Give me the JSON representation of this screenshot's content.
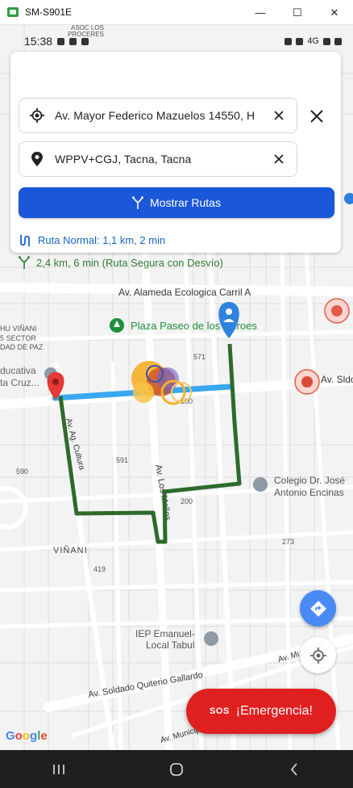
{
  "window": {
    "title": "SM-S901E",
    "minimize": "—",
    "maximize": "☐",
    "close": "✕"
  },
  "status": {
    "time": "15:38",
    "right": "4G"
  },
  "search": {
    "origin": "Av. Mayor Federico Mazuelos 14550, H",
    "destination": "WPPV+CGJ, Tacna, Tacna",
    "show_routes": "Mostrar Rutas"
  },
  "routes": {
    "normal": "Ruta Normal: 1,1 km, 2 min",
    "safe": "2,4 km, 6 min (Ruta Segura con Desvío)"
  },
  "map_labels": {
    "street_alameda": "Av. Alameda Ecologica Carril A",
    "plaza": "Plaza Paseo de los Héroes",
    "soldado": "Av. Sldo. E",
    "colegio_1": "Colegio Dr. José",
    "colegio_2": "Antonio Encinas",
    "los_molles": "Av. Los Molles",
    "vinani": "VIÑANI",
    "ag_cultura": "Av. Ag. Cultura",
    "ie_1": "IEP Emanuel-",
    "ie_2": "Local Tabul",
    "quitierio": "Av. Soldado Quiterio Gallardo",
    "municipal_1": "Av. Municipal",
    "municipal_2": "Av. Municipal",
    "hu_vinani": "HU VIÑANI",
    "sector": "5 SECTOR",
    "dad": "DAD DE PAZ",
    "educativa": "ducativa",
    "cruz": "ta Cruz...",
    "asoc": "ASOC LOS",
    "proceres": "PROCERES",
    "n571": "571",
    "n100": "100",
    "n590": "590",
    "n591": "591",
    "n200": "200",
    "n273": "273",
    "n419": "419"
  },
  "emergency": {
    "sos": "SOS",
    "label": "¡Emergencia!"
  },
  "google": {
    "g1": "G",
    "o1": "o",
    "o2": "o",
    "g2": "g",
    "l": "l",
    "e": "e"
  },
  "colors": {
    "primary_button": "#1a57d9",
    "normal_route": "#39a8f0",
    "safe_route": "#2e6b2a",
    "emergency": "#e02020",
    "pin_origin": "#2d83dd",
    "pin_destination": "#e53935"
  },
  "icons": {
    "origin": "my-location-icon",
    "destination": "place-icon",
    "clear": "close-icon",
    "routes": "fork-icon",
    "directions": "directions-icon",
    "locate": "locate-icon"
  }
}
